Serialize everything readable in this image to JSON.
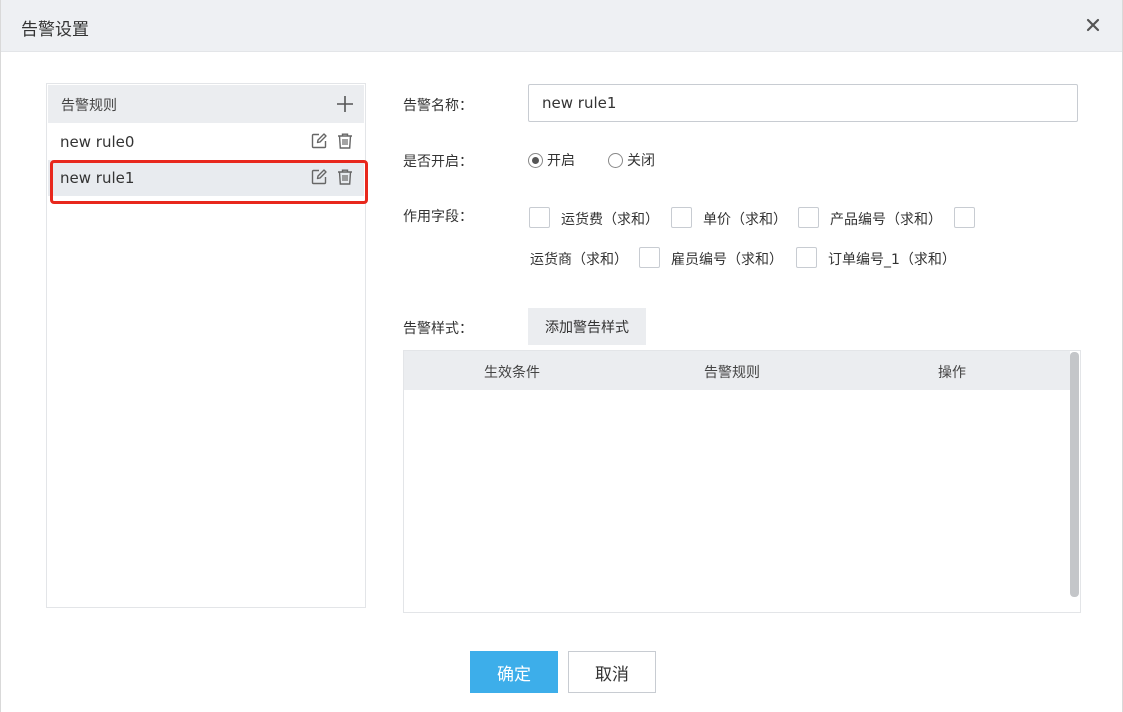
{
  "dialog": {
    "title": "告警设置",
    "close_icon": "close-icon"
  },
  "rules_panel": {
    "header_label": "告警规则",
    "add_icon": "plus-icon",
    "items": [
      {
        "label": "new rule0",
        "selected": false
      },
      {
        "label": "new rule1",
        "selected": true
      }
    ]
  },
  "form": {
    "name_label": "告警名称：",
    "name_value": "new rule1",
    "enable_label": "是否开启：",
    "enable_options": [
      {
        "label": "开启",
        "checked": true
      },
      {
        "label": "关闭",
        "checked": false
      }
    ],
    "fields_label": "作用字段：",
    "fields": [
      {
        "label": "运货费（求和）",
        "checked": false
      },
      {
        "label": "单价（求和）",
        "checked": false
      },
      {
        "label": "产品编号（求和）",
        "checked": false
      },
      {
        "label": "运货商（求和）",
        "checked": false
      },
      {
        "label": "雇员编号（求和）",
        "checked": false
      },
      {
        "label": "订单编号_1（求和）",
        "checked": false
      }
    ],
    "style_label": "告警样式：",
    "add_style_button": "添加警告样式"
  },
  "style_table": {
    "columns": [
      "生效条件",
      "告警规则",
      "操作"
    ],
    "rows": []
  },
  "footer": {
    "ok_label": "确定",
    "cancel_label": "取消"
  },
  "colors": {
    "primary": "#3daeea",
    "highlight": "#e8281d",
    "header_bg": "#eef0f3"
  }
}
